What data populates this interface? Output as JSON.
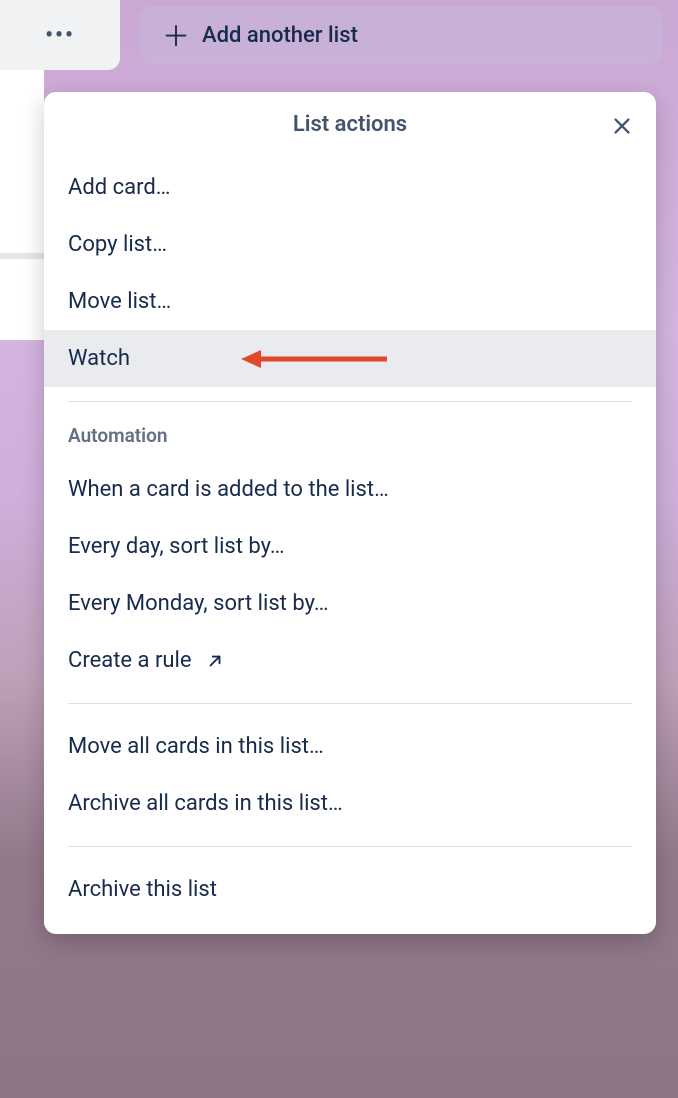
{
  "add_list_button": {
    "label": "Add another list"
  },
  "popover": {
    "title": "List actions",
    "sections": {
      "main": {
        "add_card": "Add card…",
        "copy_list": "Copy list…",
        "move_list": "Move list…",
        "watch": "Watch"
      },
      "automation": {
        "header": "Automation",
        "when_card_added": "When a card is added to the list…",
        "every_day_sort": "Every day, sort list by…",
        "every_monday_sort": "Every Monday, sort list by…",
        "create_rule": "Create a rule"
      },
      "bulk": {
        "move_all": "Move all cards in this list…",
        "archive_all": "Archive all cards in this list…"
      },
      "archive": {
        "archive_list": "Archive this list"
      }
    }
  }
}
